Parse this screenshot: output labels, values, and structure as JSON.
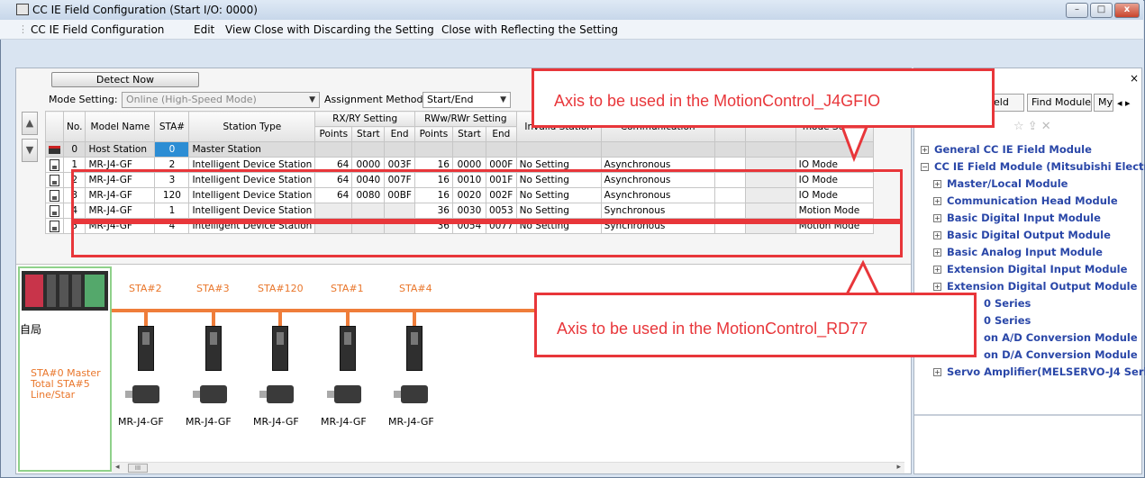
{
  "window": {
    "title": "CC IE Field Configuration (Start I/O: 0000)",
    "buttons": {
      "minimize": "–",
      "maximize": "□",
      "close": "x"
    }
  },
  "menu": [
    "CC IE Field Configuration",
    "Edit",
    "View",
    "Close with Discarding the Setting",
    "Close with Reflecting the Setting"
  ],
  "toolbar": {
    "detect_now": "Detect Now",
    "mode_label": "Mode Setting:",
    "mode_value": "Online (High-Speed Mode)",
    "assignment_label": "Assignment Method:",
    "assignment_value": "Start/End"
  },
  "scroll": {
    "up": "▲",
    "down": "▼"
  },
  "table": {
    "headers": {
      "no": "No.",
      "model": "Model Name",
      "sta": "STA#",
      "station_type": "Station Type",
      "rxry": "RX/RY Setting",
      "rwwrwr": "RWw/RWr Setting",
      "points": "Points",
      "start": "Start",
      "end": "End",
      "invalid": "Invalid Station",
      "communication": "Communication",
      "mode": "mode Setting"
    },
    "rows": [
      {
        "no": "0",
        "model": "Host Station",
        "sta": "0",
        "type": "Master Station",
        "rx_points": "",
        "rx_start": "",
        "rx_end": "",
        "rw_points": "",
        "rw_start": "",
        "rw_end": "",
        "invalid": "",
        "comm": "",
        "mode": ""
      },
      {
        "no": "1",
        "model": "MR-J4-GF",
        "sta": "2",
        "type": "Intelligent Device Station",
        "rx_points": "64",
        "rx_start": "0000",
        "rx_end": "003F",
        "rw_points": "16",
        "rw_start": "0000",
        "rw_end": "000F",
        "invalid": "No Setting",
        "comm": "Asynchronous",
        "mode": "IO Mode"
      },
      {
        "no": "2",
        "model": "MR-J4-GF",
        "sta": "3",
        "type": "Intelligent Device Station",
        "rx_points": "64",
        "rx_start": "0040",
        "rx_end": "007F",
        "rw_points": "16",
        "rw_start": "0010",
        "rw_end": "001F",
        "invalid": "No Setting",
        "comm": "Asynchronous",
        "mode": "IO Mode"
      },
      {
        "no": "3",
        "model": "MR-J4-GF",
        "sta": "120",
        "type": "Intelligent Device Station",
        "rx_points": "64",
        "rx_start": "0080",
        "rx_end": "00BF",
        "rw_points": "16",
        "rw_start": "0020",
        "rw_end": "002F",
        "invalid": "No Setting",
        "comm": "Asynchronous",
        "mode": "IO Mode"
      },
      {
        "no": "4",
        "model": "MR-J4-GF",
        "sta": "1",
        "type": "Intelligent Device Station",
        "rx_points": "",
        "rx_start": "",
        "rx_end": "",
        "rw_points": "36",
        "rw_start": "0030",
        "rw_end": "0053",
        "invalid": "No Setting",
        "comm": "Synchronous",
        "mode": "Motion Mode"
      },
      {
        "no": "5",
        "model": "MR-J4-GF",
        "sta": "4",
        "type": "Intelligent Device Station",
        "rx_points": "",
        "rx_start": "",
        "rx_end": "",
        "rw_points": "36",
        "rw_start": "0054",
        "rw_end": "0077",
        "invalid": "No Setting",
        "comm": "Synchronous",
        "mode": "Motion Mode"
      }
    ]
  },
  "callouts": {
    "top": "Axis to be used in the MotionControl_J4GFIO",
    "bottom": "Axis to be used in the MotionControl_RD77"
  },
  "diagram": {
    "master_label": "自局",
    "master_info": [
      "STA#0  Master",
      "Total STA#5",
      "Line/Star"
    ],
    "stations": [
      "STA#2",
      "STA#3",
      "STA#120",
      "STA#1",
      "STA#4"
    ],
    "models": [
      "MR-J4-GF",
      "MR-J4-GF",
      "MR-J4-GF",
      "MR-J4-GF",
      "MR-J4-GF"
    ],
    "scroll_thumb": "III",
    "scroll_left": "◂",
    "scroll_right": "▸"
  },
  "right_panel": {
    "close": "×",
    "tabs": [
      "eld",
      "Find Module",
      "My",
      "◂ ▸"
    ],
    "tree": [
      {
        "sign": "+",
        "label": "General CC IE Field Module",
        "level": 0
      },
      {
        "sign": "−",
        "label": "CC IE Field Module (Mitsubishi Electric",
        "level": 0
      },
      {
        "sign": "+",
        "label": "Master/Local Module",
        "level": 1
      },
      {
        "sign": "+",
        "label": "Communication Head Module",
        "level": 1
      },
      {
        "sign": "+",
        "label": "Basic Digital Input Module",
        "level": 1
      },
      {
        "sign": "+",
        "label": "Basic Digital Output Module",
        "level": 1
      },
      {
        "sign": "+",
        "label": "Basic Analog Input Module",
        "level": 1
      },
      {
        "sign": "+",
        "label": "Extension Digital Input Module",
        "level": 1
      },
      {
        "sign": "+",
        "label": "Extension Digital Output Module",
        "level": 1
      },
      {
        "sign": "",
        "label": "0 Series",
        "level": 2
      },
      {
        "sign": "",
        "label": "0 Series",
        "level": 2
      },
      {
        "sign": "",
        "label": "on A/D Conversion Module",
        "level": 2
      },
      {
        "sign": "",
        "label": "on D/A Conversion Module",
        "level": 2
      },
      {
        "sign": "+",
        "label": "Servo Amplifier(MELSERVO-J4 Seri",
        "level": 1
      }
    ]
  },
  "colors": {
    "callout_red": "#e8363a",
    "bus_orange": "#ef7d3a",
    "tree_blue": "#2a47a8",
    "host_sta_blue": "#2c8dd4",
    "master_green": "#8fd18a"
  }
}
